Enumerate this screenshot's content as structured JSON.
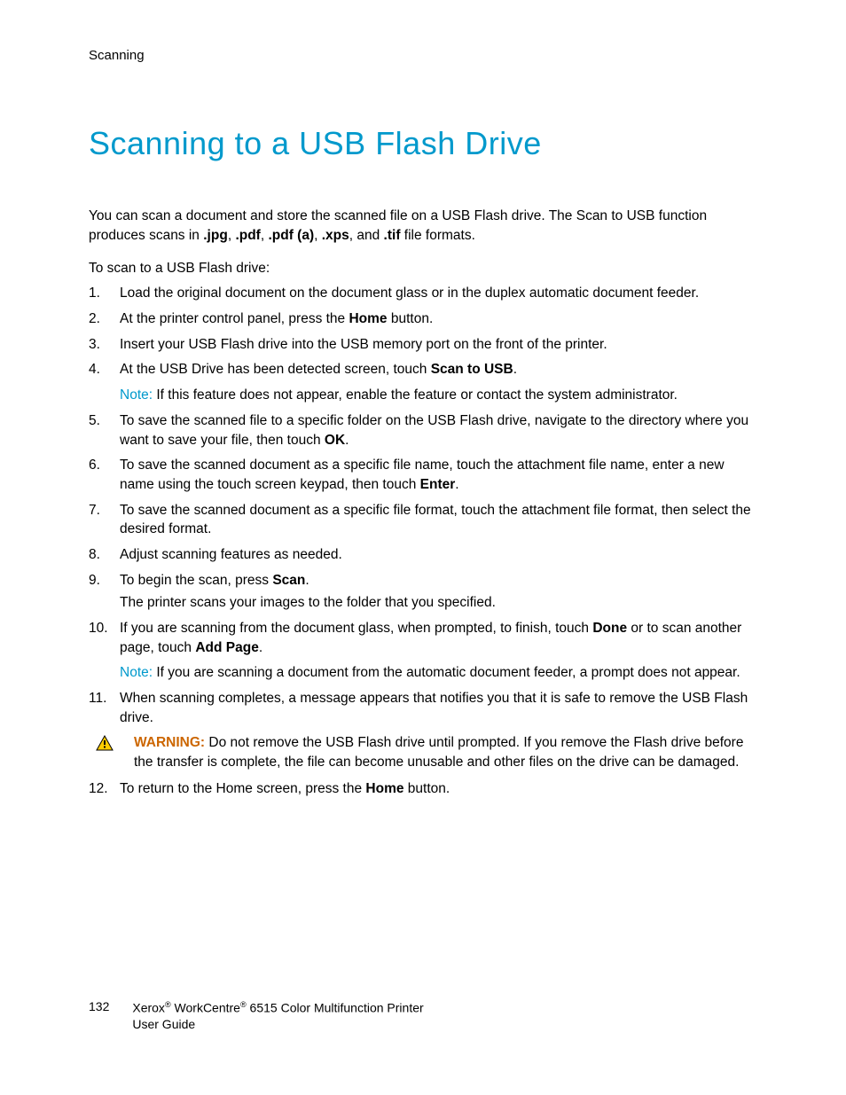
{
  "header": {
    "section": "Scanning"
  },
  "title": "Scanning to a USB Flash Drive",
  "intro": {
    "t1": "You can scan a document and store the scanned file on a USB Flash drive. The Scan to USB function produces scans in ",
    "f1": ".jpg",
    "c1": ", ",
    "f2": ".pdf",
    "c2": ", ",
    "f3": ".pdf (a)",
    "c3": ", ",
    "f4": ".xps",
    "c4": ", and ",
    "f5": ".tif",
    "t2": " file formats."
  },
  "sub": "To scan to a USB Flash drive:",
  "steps": {
    "s1": "Load the original document on the document glass or in the duplex automatic document feeder.",
    "s2a": "At the printer control panel, press the ",
    "s2b": "Home",
    "s2c": " button.",
    "s3": "Insert your USB Flash drive into the USB memory port on the front of the printer.",
    "s4a": "At the USB Drive has been detected screen, touch ",
    "s4b": "Scan to USB",
    "s4c": ".",
    "note1a": "Note:",
    "note1b": " If this feature does not appear, enable the feature or contact the system administrator.",
    "s5a": "To save the scanned file to a specific folder on the USB Flash drive, navigate to the directory where you want to save your file, then touch ",
    "s5b": "OK",
    "s5c": ".",
    "s6a": "To save the scanned document as a specific file name, touch the attachment file name, enter a new name using the touch screen keypad, then touch ",
    "s6b": "Enter",
    "s6c": ".",
    "s7": "To save the scanned document as a specific file format, touch the attachment file format, then select the desired format.",
    "s8": "Adjust scanning features as needed.",
    "s9a": "To begin the scan, press ",
    "s9b": "Scan",
    "s9c": ".",
    "s9d": "The printer scans your images to the folder that you specified.",
    "s10a": "If you are scanning from the document glass, when prompted, to finish, touch ",
    "s10b": "Done",
    "s10c": " or to scan another page, touch ",
    "s10d": "Add Page",
    "s10e": ".",
    "note2a": "Note:",
    "note2b": " If you are scanning a document from the automatic document feeder, a prompt does not appear.",
    "s11": "When scanning completes, a message appears that notifies you that it is safe to remove the USB Flash drive.",
    "warnLabel": "WARNING:",
    "warnText": " Do not remove the USB Flash drive until prompted. If you remove the Flash drive before the transfer is complete, the file can become unusable and other files on the drive can be damaged.",
    "s12a": "To return to the Home screen, press the ",
    "s12b": "Home",
    "s12c": " button."
  },
  "footer": {
    "page": "132",
    "line1a": "Xerox",
    "line1b": " WorkCentre",
    "line1c": " 6515 Color Multifunction Printer",
    "line2": "User Guide",
    "reg": "®"
  }
}
